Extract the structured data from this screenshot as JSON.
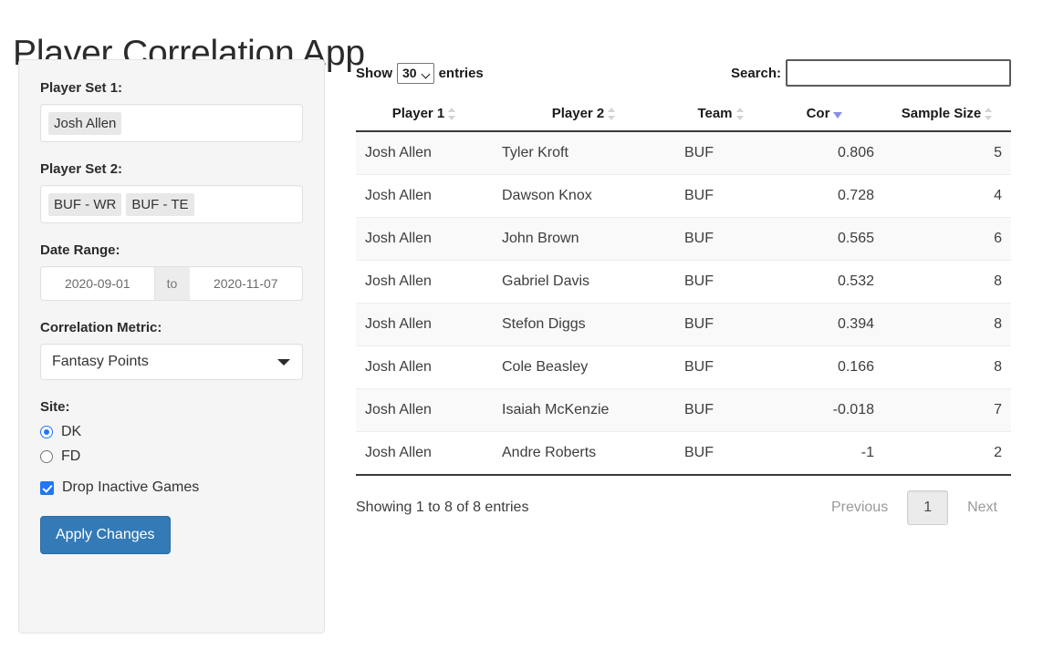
{
  "app": {
    "title": "Player Correlation App"
  },
  "sidebar": {
    "player_set_1": {
      "label": "Player Set 1:",
      "tags": [
        "Josh Allen"
      ]
    },
    "player_set_2": {
      "label": "Player Set 2:",
      "tags": [
        "BUF - WR",
        "BUF - TE"
      ]
    },
    "date_range": {
      "label": "Date Range:",
      "start": "2020-09-01",
      "end": "2020-11-07",
      "separator": "to"
    },
    "correlation_metric": {
      "label": "Correlation Metric:",
      "selected": "Fantasy Points"
    },
    "site": {
      "label": "Site:",
      "options": [
        {
          "label": "DK",
          "selected": true
        },
        {
          "label": "FD",
          "selected": false
        }
      ]
    },
    "drop_inactive": {
      "label": "Drop Inactive Games",
      "checked": true
    },
    "apply_button": "Apply Changes"
  },
  "table_controls": {
    "show_prefix": "Show",
    "page_length": "30",
    "show_suffix": "entries",
    "search_label": "Search:",
    "search_value": "",
    "search_placeholder": ""
  },
  "table": {
    "columns": [
      {
        "label": "Player 1",
        "sort": "none"
      },
      {
        "label": "Player 2",
        "sort": "none"
      },
      {
        "label": "Team",
        "sort": "none"
      },
      {
        "label": "Cor",
        "sort": "desc"
      },
      {
        "label": "Sample Size",
        "sort": "none"
      }
    ],
    "rows": [
      {
        "player1": "Josh Allen",
        "player2": "Tyler Kroft",
        "team": "BUF",
        "cor": "0.806",
        "sample_size": "5"
      },
      {
        "player1": "Josh Allen",
        "player2": "Dawson Knox",
        "team": "BUF",
        "cor": "0.728",
        "sample_size": "4"
      },
      {
        "player1": "Josh Allen",
        "player2": "John Brown",
        "team": "BUF",
        "cor": "0.565",
        "sample_size": "6"
      },
      {
        "player1": "Josh Allen",
        "player2": "Gabriel Davis",
        "team": "BUF",
        "cor": "0.532",
        "sample_size": "8"
      },
      {
        "player1": "Josh Allen",
        "player2": "Stefon Diggs",
        "team": "BUF",
        "cor": "0.394",
        "sample_size": "8"
      },
      {
        "player1": "Josh Allen",
        "player2": "Cole Beasley",
        "team": "BUF",
        "cor": "0.166",
        "sample_size": "8"
      },
      {
        "player1": "Josh Allen",
        "player2": "Isaiah McKenzie",
        "team": "BUF",
        "cor": "-0.018",
        "sample_size": "7"
      },
      {
        "player1": "Josh Allen",
        "player2": "Andre Roberts",
        "team": "BUF",
        "cor": "-1",
        "sample_size": "2"
      }
    ]
  },
  "pagination": {
    "info": "Showing 1 to 8 of 8 entries",
    "previous": "Previous",
    "next": "Next",
    "pages": [
      "1"
    ],
    "current_page": "1"
  },
  "colors": {
    "primary_button": "#337ab7",
    "accent": "#2176f5",
    "sort_active": "#8a8fe0",
    "panel_bg": "#f5f5f5",
    "row_stripe": "#f9f9f9"
  }
}
